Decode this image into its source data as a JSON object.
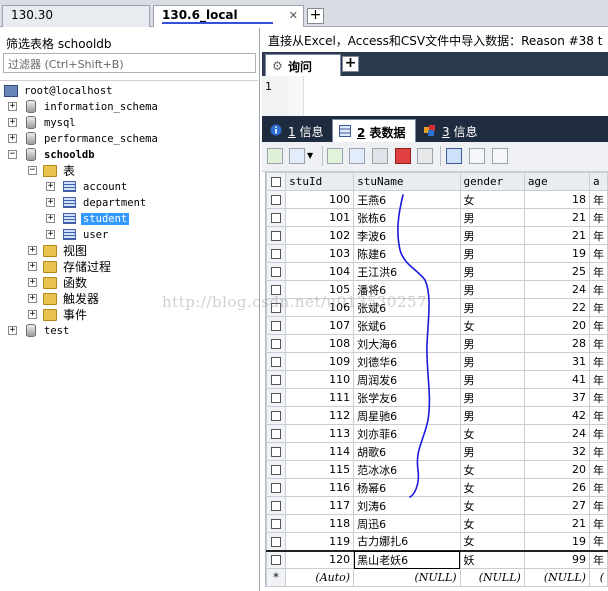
{
  "connection_tabs": [
    {
      "label": "130.30"
    },
    {
      "label": "130.6_local",
      "close_glyph": "✕"
    }
  ],
  "add_connection_glyph": "+",
  "sidebar": {
    "filter_label": "筛选表格 schooldb",
    "filter_placeholder": "过滤器 (Ctrl+Shift+B)",
    "root": "root@localhost",
    "databases": [
      {
        "name": "information_schema"
      },
      {
        "name": "mysql"
      },
      {
        "name": "performance_schema"
      },
      {
        "name": "schooldb"
      },
      {
        "name": "test"
      }
    ],
    "schooldb_children": {
      "tables_folder": "表",
      "tables": [
        "account",
        "department",
        "student",
        "user"
      ],
      "views": "视图",
      "procedures": "存储过程",
      "functions": "函数",
      "triggers": "触发器",
      "events": "事件"
    },
    "expand_glyph": "+",
    "collapse_glyph": "−"
  },
  "query": {
    "title": "直接从Excel，Access和CSV文件中导入数据：Reason #38 t",
    "tab_label": "询问",
    "add_glyph": "+",
    "line_number": "1"
  },
  "result_tabs": [
    {
      "num": "1",
      "label": "信息"
    },
    {
      "num": "2",
      "label": "表数据"
    },
    {
      "num": "3",
      "label": "信息"
    }
  ],
  "table": {
    "columns": [
      "stuId",
      "stuName",
      "gender",
      "age",
      "a"
    ],
    "rows": [
      [
        "100",
        "王燕6",
        "女",
        "18",
        "年"
      ],
      [
        "101",
        "张栋6",
        "男",
        "21",
        "年"
      ],
      [
        "102",
        "李波6",
        "男",
        "21",
        "年"
      ],
      [
        "103",
        "陈建6",
        "男",
        "19",
        "年"
      ],
      [
        "104",
        "王江洪6",
        "男",
        "25",
        "年"
      ],
      [
        "105",
        "潘将6",
        "男",
        "24",
        "年"
      ],
      [
        "106",
        "张斌6",
        "男",
        "22",
        "年"
      ],
      [
        "107",
        "张斌6",
        "女",
        "20",
        "年"
      ],
      [
        "108",
        "刘大海6",
        "男",
        "28",
        "年"
      ],
      [
        "109",
        "刘德华6",
        "男",
        "31",
        "年"
      ],
      [
        "110",
        "周润发6",
        "男",
        "41",
        "年"
      ],
      [
        "111",
        "张学友6",
        "男",
        "37",
        "年"
      ],
      [
        "112",
        "周星驰6",
        "男",
        "42",
        "年"
      ],
      [
        "113",
        "刘亦菲6",
        "女",
        "24",
        "年"
      ],
      [
        "114",
        "胡歌6",
        "男",
        "32",
        "年"
      ],
      [
        "115",
        "范冰冰6",
        "女",
        "20",
        "年"
      ],
      [
        "116",
        "杨幂6",
        "女",
        "26",
        "年"
      ],
      [
        "117",
        "刘涛6",
        "女",
        "27",
        "年"
      ],
      [
        "118",
        "周迅6",
        "女",
        "21",
        "年"
      ],
      [
        "119",
        "古力娜扎6",
        "女",
        "19",
        "年"
      ],
      [
        "120",
        "黑山老妖6",
        "妖",
        "99",
        "年"
      ]
    ],
    "new_row": [
      "(Auto)",
      "(NULL)",
      "(NULL)",
      "(NULL)",
      "("
    ],
    "new_row_marker": "*"
  },
  "watermark": "http://blog.csdn.net/u013530257",
  "colors": {
    "annotation": "#1a1adc",
    "selection": "#3399ff",
    "tab_underline": "#3550d8"
  }
}
